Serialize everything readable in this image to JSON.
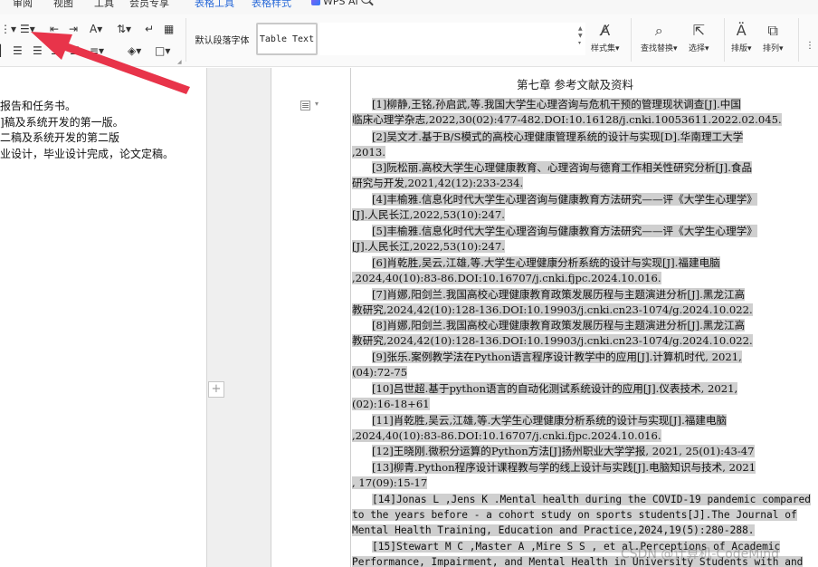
{
  "tabs": [
    "审阅",
    "视图",
    "工具",
    "会员专享",
    "表格工具",
    "表格样式",
    "WPS AI"
  ],
  "ribbon": {
    "style_normal": "默认段落字体",
    "style_table": "Table Text",
    "styles_set": "样式集",
    "find_replace": "查找替换",
    "select": "选择",
    "layout": "排版",
    "arrange": "排列"
  },
  "left_doc": {
    "lines": [
      "报告和任务书。",
      "]稿及系统开发的第一版。",
      "二稿及系统开发的第二版",
      "业设计，毕业设计完成，论文定稿。"
    ]
  },
  "page": {
    "chapter_title": "第七章  参考文献及资料",
    "lines": [
      "[1]柳静,王铭,孙启武,等.我国大学生心理咨询与危机干预的管理现状调查[J].中国",
      "临床心理学杂志,2022,30(02):477-482.DOI:10.16128/j.cnki.10053611.2022.02.045.",
      "[2]吴文才.基于B/S模式的高校心理健康管理系统的设计与实现[D].华南理工大学",
      ",2013.",
      "[3]阮松丽.高校大学生心理健康教育、心理咨询与德育工作相关性研究分析[J].食品",
      "研究与开发,2021,42(12):233-234.",
      "[4]丰榆雅.信息化时代大学生心理咨询与健康教育方法研究——评《大学生心理学》",
      "[J].人民长江,2022,53(10):247.",
      "[5]丰榆雅.信息化时代大学生心理咨询与健康教育方法研究——评《大学生心理学》",
      "[J].人民长江,2022,53(10):247.",
      "[6]肖乾胜,吴云,江雄,等.大学生心理健康分析系统的设计与实现[J].福建电脑",
      ",2024,40(10):83-86.DOI:10.16707/j.cnki.fjpc.2024.10.016.",
      "[7]肖娜,阳剑兰.我国高校心理健康教育政策发展历程与主题演进分析[J].黑龙江高",
      "教研究,2024,42(10):128-136.DOI:10.19903/j.cnki.cn23-1074/g.2024.10.022.",
      "[8]肖娜,阳剑兰.我国高校心理健康教育政策发展历程与主题演进分析[J].黑龙江高",
      "教研究,2024,42(10):128-136.DOI:10.19903/j.cnki.cn23-1074/g.2024.10.022.",
      "[9]张乐.案例教学法在Python语言程序设计教学中的应用[J].计算机时代, 2021,",
      "(04):72-75",
      "[10]吕世超.基于python语言的自动化测试系统设计的应用[J].仪表技术, 2021,",
      "(02):16-18+61",
      "[11]肖乾胜,吴云,江雄,等.大学生心理健康分析系统的设计与实现[J].福建电脑",
      ",2024,40(10):83-86.DOI:10.16707/j.cnki.fjpc.2024.10.016.",
      "[12]王晓刚.微积分运算的Python方法[J]扬州职业大学学报, 2021, 25(01):43-47",
      "[13]柳青.Python程序设计课程教与学的线上设计与实践[J].电脑知识与技术, 2021",
      ", 17(09):15-17",
      "[14]Jonas L ,Jens K .Mental health during the COVID-19 pandemic compared",
      "to the years before  - a cohort study on sports students[J].The Journal of",
      "Mental Health Training, Education and Practice,2024,19(5):280-288.",
      "[15]Stewart M C ,Master A ,Mire S S , et al.Perceptions of Academic",
      "Performance, Impairment, and Mental Health in University Students with and"
    ]
  },
  "watermark": "CSDN @计算机-CodeMind",
  "colors": {
    "highlight": "#cfcfcf",
    "arrow": "#e8344a",
    "tab_blue": "#2a6ad8"
  }
}
